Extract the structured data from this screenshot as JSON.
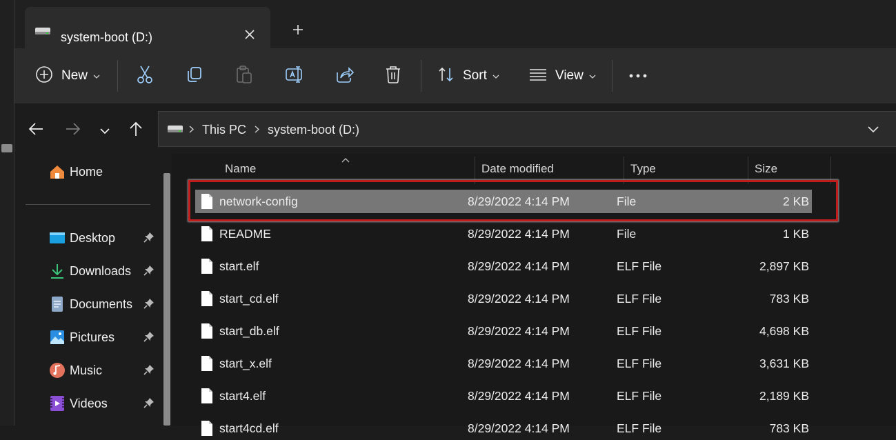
{
  "tab": {
    "title": "system-boot (D:)",
    "close_icon": "close-icon",
    "new_tab_icon": "plus-icon"
  },
  "toolbar": {
    "new_label": "New",
    "sort_label": "Sort",
    "view_label": "View",
    "buttons": [
      "cut-icon",
      "copy-icon",
      "paste-icon",
      "rename-icon",
      "share-icon",
      "delete-icon",
      "more-icon"
    ]
  },
  "address": {
    "crumbs": [
      "This PC",
      "system-boot (D:)"
    ]
  },
  "sidebar": {
    "home": "Home",
    "items": [
      {
        "label": "Desktop",
        "icon": "desktop-icon"
      },
      {
        "label": "Downloads",
        "icon": "downloads-icon"
      },
      {
        "label": "Documents",
        "icon": "documents-icon"
      },
      {
        "label": "Pictures",
        "icon": "pictures-icon"
      },
      {
        "label": "Music",
        "icon": "music-icon"
      },
      {
        "label": "Videos",
        "icon": "videos-icon"
      }
    ]
  },
  "columns": {
    "name": "Name",
    "date": "Date modified",
    "type": "Type",
    "size": "Size"
  },
  "files": [
    {
      "name": "network-config",
      "date": "8/29/2022 4:14 PM",
      "type": "File",
      "size": "2 KB",
      "selected": true
    },
    {
      "name": "README",
      "date": "8/29/2022 4:14 PM",
      "type": "File",
      "size": "1 KB"
    },
    {
      "name": "start.elf",
      "date": "8/29/2022 4:14 PM",
      "type": "ELF File",
      "size": "2,897 KB"
    },
    {
      "name": "start_cd.elf",
      "date": "8/29/2022 4:14 PM",
      "type": "ELF File",
      "size": "783 KB"
    },
    {
      "name": "start_db.elf",
      "date": "8/29/2022 4:14 PM",
      "type": "ELF File",
      "size": "4,698 KB"
    },
    {
      "name": "start_x.elf",
      "date": "8/29/2022 4:14 PM",
      "type": "ELF File",
      "size": "3,631 KB"
    },
    {
      "name": "start4.elf",
      "date": "8/29/2022 4:14 PM",
      "type": "ELF File",
      "size": "2,189 KB"
    },
    {
      "name": "start4cd.elf",
      "date": "8/29/2022 4:14 PM",
      "type": "ELF File",
      "size": "783 KB"
    }
  ],
  "colors": {
    "selection": "#777777",
    "highlight_border": "#c21d1d"
  }
}
